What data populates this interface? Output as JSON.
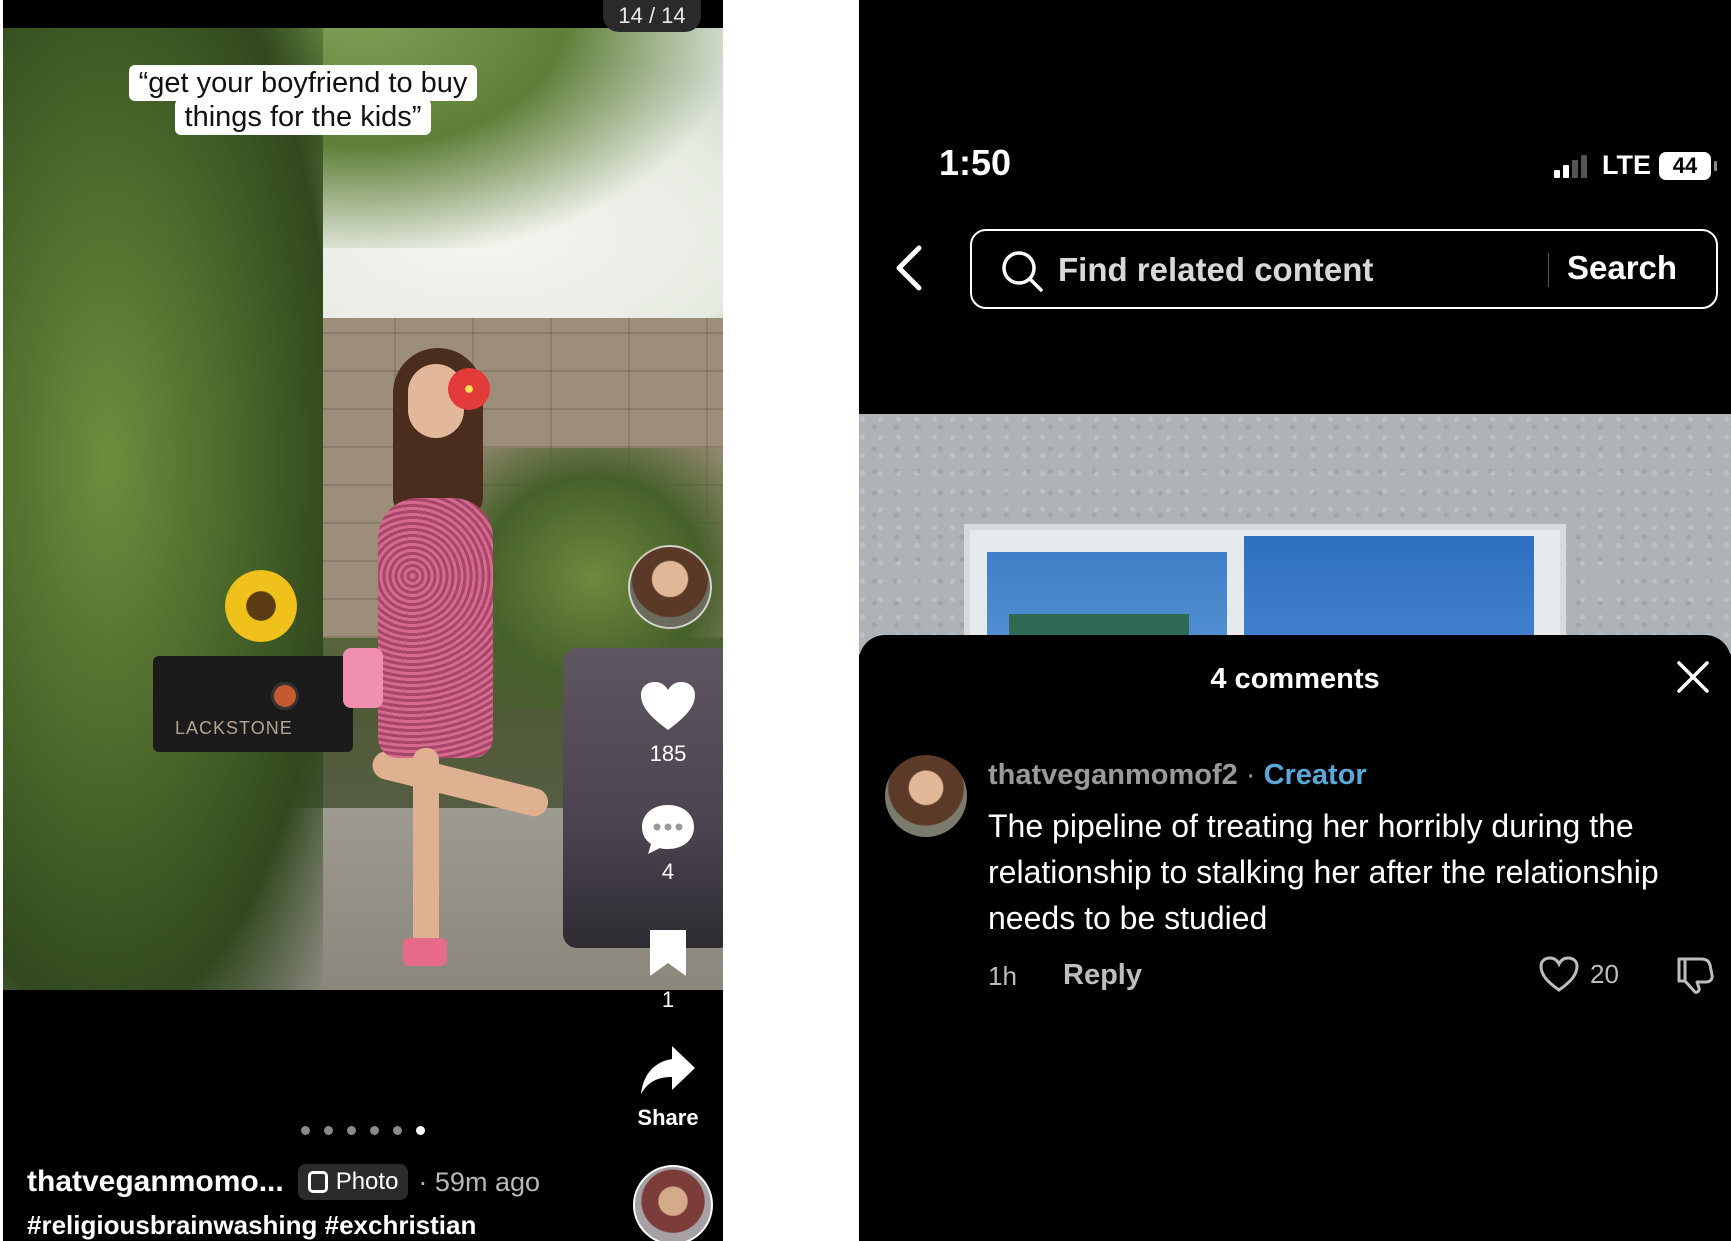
{
  "left_screen": {
    "counter": "14 / 14",
    "overlay_caption": "“get your boyfriend to buy things for the kids”",
    "photo_sign_text": "LACKSTONE",
    "actions": {
      "likes": "185",
      "comments": "4",
      "saves": "1",
      "share_label": "Share"
    },
    "carousel": {
      "total_dots": 6,
      "active_index": 5
    },
    "author": "thatveganmomo...",
    "chip_label": "Photo",
    "time_ago": "· 59m ago",
    "hashtags": "#religiousbrainwashing #exchristian"
  },
  "right_screen": {
    "status_bar": {
      "time": "1:50",
      "network": "LTE",
      "battery": "44"
    },
    "search": {
      "placeholder": "Find related content",
      "button": "Search"
    },
    "comments_sheet": {
      "title": "4 comments",
      "comments": [
        {
          "username": "thatveganmomof2",
          "separator": "·",
          "badge": "Creator",
          "text": "The pipeline of treating her horribly during the relationship to stalking her after the relationship needs to be studied",
          "time": "1h",
          "reply_label": "Reply",
          "likes": "20"
        }
      ]
    }
  },
  "colors": {
    "background": "#000000",
    "creator_badge": "#5aa7d8",
    "muted_text": "#9a9a9a"
  },
  "icons": [
    "heart-icon",
    "comment-bubble-icon",
    "bookmark-icon",
    "share-arrow-icon",
    "back-chevron-icon",
    "search-icon",
    "close-icon",
    "dislike-icon"
  ]
}
